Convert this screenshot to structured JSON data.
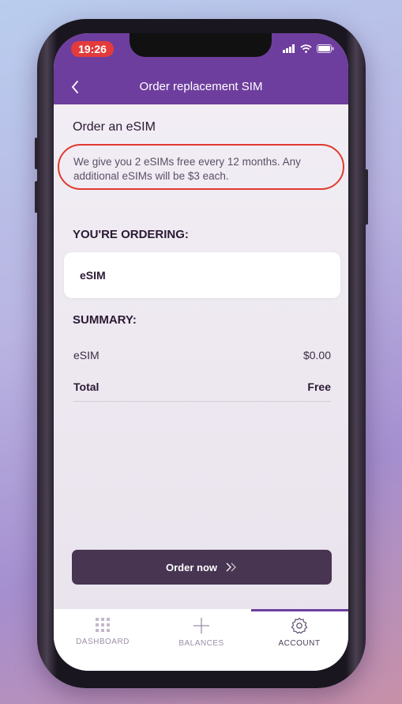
{
  "status_bar": {
    "time": "19:26"
  },
  "header": {
    "title": "Order replacement SIM"
  },
  "main": {
    "section_title": "Order an eSIM",
    "info_text": "We give you 2 eSIMs free every 12 months. Any additional eSIMs will be $3 each.",
    "ordering_title": "YOU'RE ORDERING:",
    "ordering_item": "eSIM",
    "summary_title": "SUMMARY:",
    "summary_rows": [
      {
        "label": "eSIM",
        "value": "$0.00"
      },
      {
        "label": "Total",
        "value": "Free"
      }
    ],
    "order_button": "Order now"
  },
  "tabs": [
    {
      "label": "DASHBOARD",
      "icon": "grid-icon"
    },
    {
      "label": "BALANCES",
      "icon": "plus-icon"
    },
    {
      "label": "ACCOUNT",
      "icon": "gear-icon",
      "active": true
    }
  ],
  "colors": {
    "brand": "#6e3e9e",
    "button": "#473552",
    "highlight": "#e03a2e",
    "time_pill": "#e33b3b"
  }
}
